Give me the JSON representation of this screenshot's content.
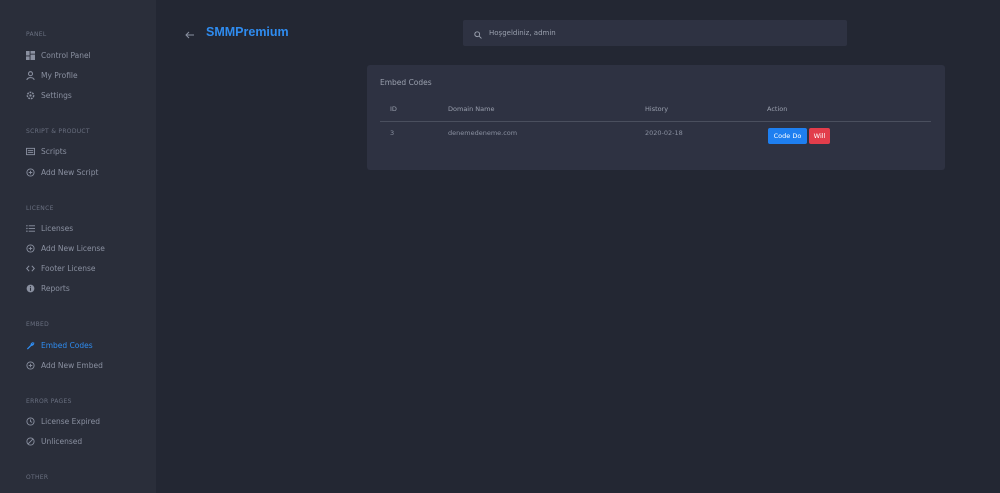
{
  "sidebar": {
    "sections": [
      {
        "title": "PANEL",
        "items": [
          {
            "label": "Control Panel",
            "icon": "dashboard-icon"
          },
          {
            "label": "My Profile",
            "icon": "user-icon"
          },
          {
            "label": "Settings",
            "icon": "gear-icon"
          }
        ]
      },
      {
        "title": "SCRIPT & PRODUCT",
        "items": [
          {
            "label": "Scripts",
            "icon": "list-icon"
          },
          {
            "label": "Add New Script",
            "icon": "plus-circle-icon"
          }
        ]
      },
      {
        "title": "LICENCE",
        "items": [
          {
            "label": "Licenses",
            "icon": "list-lines-icon"
          },
          {
            "label": "Add New License",
            "icon": "plus-circle-icon"
          },
          {
            "label": "Footer License",
            "icon": "code-icon"
          },
          {
            "label": "Reports",
            "icon": "info-icon"
          }
        ]
      },
      {
        "title": "EMBED",
        "items": [
          {
            "label": "Embed Codes",
            "icon": "wrench-icon",
            "active": true
          },
          {
            "label": "Add New Embed",
            "icon": "plus-circle-icon"
          }
        ]
      },
      {
        "title": "ERROR PAGES",
        "items": [
          {
            "label": "License Expired",
            "icon": "clock-icon"
          },
          {
            "label": "Unlicensed",
            "icon": "ban-icon"
          }
        ]
      },
      {
        "title": "OTHER",
        "items": []
      }
    ]
  },
  "header": {
    "brand": "SMMPremium",
    "search_placeholder": "Hoşgeldiniz, admin"
  },
  "card": {
    "title": "Embed Codes",
    "columns": [
      "ID",
      "Domain Name",
      "History",
      "Action"
    ],
    "rows": [
      {
        "id": "3",
        "domain": "denemedeneme.com",
        "history": "2020-02-18",
        "code_label": "Code Do",
        "delete_label": "Will"
      }
    ]
  },
  "colors": {
    "accent": "#2f8cf0",
    "danger": "#e23d4b",
    "background": "#232733",
    "sidebar": "#2a2e3a",
    "card": "#2e3242"
  }
}
